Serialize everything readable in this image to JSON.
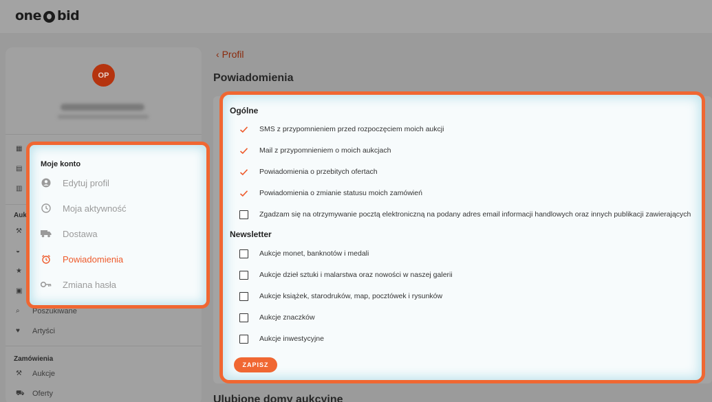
{
  "app": {
    "logo_left": "one",
    "logo_right": "bid"
  },
  "sidebar": {
    "avatar_initials": "OP",
    "section_auctions": "Aukc",
    "item_searched": "Poszukiwane",
    "item_artists": "Artyści",
    "section_orders": "Zamówienia",
    "item_orders_auctions": "Aukcje",
    "item_orders_offers": "Oferty"
  },
  "menu": {
    "title": "Moje konto",
    "items": [
      {
        "label": "Edytuj profil",
        "icon": "user-circle-icon"
      },
      {
        "label": "Moja aktywność",
        "icon": "clock-icon"
      },
      {
        "label": "Dostawa",
        "icon": "truck-icon"
      },
      {
        "label": "Powiadomienia",
        "icon": "alarm-clock-icon",
        "active": true
      },
      {
        "label": "Zmiana hasła",
        "icon": "key-icon"
      }
    ]
  },
  "main": {
    "back_label": "Profil",
    "title": "Powiadomienia",
    "bottom_title": "Ulubione domy aukcyjne"
  },
  "panel": {
    "general_title": "Ogólne",
    "general_options": [
      {
        "label": "SMS z przypomnieniem przed rozpoczęciem moich aukcji",
        "checked": true
      },
      {
        "label": "Mail z przypomnieniem o moich aukcjach",
        "checked": true
      },
      {
        "label": "Powiadomienia o przebitych ofertach",
        "checked": true
      },
      {
        "label": "Powiadomienia o zmianie statusu moich zamówień",
        "checked": true
      },
      {
        "label": "Zgadzam się na otrzymywanie pocztą elektroniczną na podany adres email informacji handlowych oraz innych publikacji zawierających",
        "checked": false
      }
    ],
    "newsletter_title": "Newsletter",
    "newsletter_options": [
      {
        "label": "Aukcje monet, banknotów i medali",
        "checked": false
      },
      {
        "label": "Aukcje dzieł sztuki i malarstwa oraz nowości w naszej galerii",
        "checked": false
      },
      {
        "label": "Aukcje książek, starodruków, map, pocztówek i rysunków",
        "checked": false
      },
      {
        "label": "Aukcje znaczków",
        "checked": false
      },
      {
        "label": "Aukcje inwestycyjne",
        "checked": false
      }
    ],
    "save_label": "ZAPISZ"
  },
  "colors": {
    "accent": "#f06732",
    "active_text": "#ee5a2b",
    "muted_text": "#9a9a9a"
  }
}
